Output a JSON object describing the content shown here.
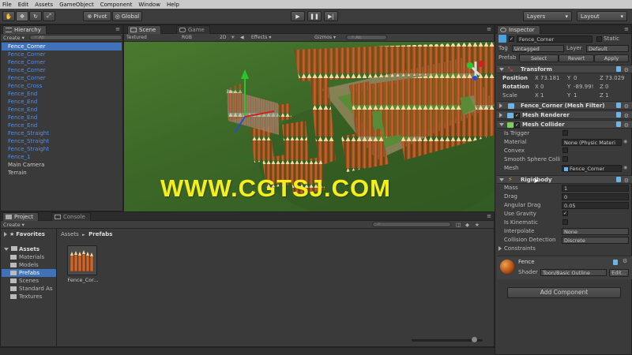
{
  "menu": [
    "File",
    "Edit",
    "Assets",
    "GameObject",
    "Component",
    "Window",
    "Help"
  ],
  "toolbar": {
    "pivot": "Pivot",
    "global": "Global",
    "layers": "Layers",
    "layout": "Layout"
  },
  "hierarchy": {
    "tab": "Hierarchy",
    "create": "Create",
    "search_placeholder": "All",
    "items": [
      {
        "label": "Fence_Corner",
        "style": "selected"
      },
      {
        "label": "Fence_Corner",
        "style": "blue"
      },
      {
        "label": "Fence_Corner",
        "style": "blue"
      },
      {
        "label": "Fence_Corner",
        "style": "blue"
      },
      {
        "label": "Fence_Corner",
        "style": "blue"
      },
      {
        "label": "Fence_Cross",
        "style": "blue"
      },
      {
        "label": "Fence_End",
        "style": "blue"
      },
      {
        "label": "Fence_End",
        "style": "blue"
      },
      {
        "label": "Fence_End",
        "style": "blue"
      },
      {
        "label": "Fence_End",
        "style": "blue"
      },
      {
        "label": "Fence_End",
        "style": "blue"
      },
      {
        "label": "Fence_Straight",
        "style": "blue"
      },
      {
        "label": "Fence_Straight",
        "style": "blue"
      },
      {
        "label": "Fence_Straight",
        "style": "blue"
      },
      {
        "label": "Fence_1",
        "style": "blue"
      },
      {
        "label": "Main Camera",
        "style": "normal"
      },
      {
        "label": "Terrain",
        "style": "normal"
      }
    ]
  },
  "scene": {
    "tab_scene": "Scene",
    "tab_game": "Game",
    "textured": "Textured",
    "rgb": "RGB",
    "twod": "2D",
    "effects": "Effects",
    "gizmos": "Gizmos",
    "search_placeholder": "All",
    "watermark": "WWW.CGTSJ.COM"
  },
  "project": {
    "tab_project": "Project",
    "tab_console": "Console",
    "create": "Create",
    "favorites": "Favorites",
    "assets": "Assets",
    "folders": [
      "Materials",
      "Models",
      "Prefabs",
      "Scenes",
      "Standard As",
      "Textures"
    ],
    "breadcrumb_root": "Assets",
    "breadcrumb_sep": "►",
    "breadcrumb_current": "Prefabs",
    "asset_label": "Fence_Cor..."
  },
  "inspector": {
    "tab": "Inspector",
    "object_name": "Fence_Corner",
    "static_label": "Static",
    "tag_label": "Tag",
    "tag_value": "Untagged",
    "layer_label": "Layer",
    "layer_value": "Default",
    "prefab_label": "Prefab",
    "select": "Select",
    "revert": "Revert",
    "apply": "Apply",
    "transform": {
      "title": "Transform",
      "position_label": "Position",
      "pos_x": "73.181",
      "pos_y": "0",
      "pos_z": "73.029",
      "rotation_label": "Rotation",
      "rot_x": "0",
      "rot_y": "-89.99!",
      "rot_z": "0",
      "scale_label": "Scale",
      "scale_x": "1",
      "scale_y": "1",
      "scale_z": "1",
      "x": "X",
      "y": "Y",
      "z": "Z"
    },
    "mesh_filter_title": "Fence_Corner (Mesh Filter)",
    "mesh_renderer_title": "Mesh Renderer",
    "mesh_collider": {
      "title": "Mesh Collider",
      "is_trigger": "Is Trigger",
      "material": "Material",
      "material_value": "None (Physic Materi",
      "convex": "Convex",
      "smooth": "Smooth Sphere Colli",
      "mesh": "Mesh",
      "mesh_value": "Fence_Corner"
    },
    "rigidbody": {
      "title": "Rigidbody",
      "mass": "Mass",
      "mass_value": "1",
      "drag": "Drag",
      "drag_value": "0",
      "angular_drag": "Angular Drag",
      "angular_drag_value": "0.05",
      "use_gravity": "Use Gravity",
      "is_kinematic": "Is Kinematic",
      "interpolate": "Interpolate",
      "interpolate_value": "None",
      "collision": "Collision Detection",
      "collision_value": "Discrete",
      "constraints": "Constraints"
    },
    "material": {
      "name": "Fence",
      "shader_label": "Shader",
      "shader_value": "Toon/Basic Outline",
      "edit": "Edit..."
    },
    "add_component": "Add Component"
  },
  "colors": {
    "accent_blue": "#3f72b9",
    "prefab_blue": "#4a8fff",
    "watermark": "#f5ee1c"
  }
}
